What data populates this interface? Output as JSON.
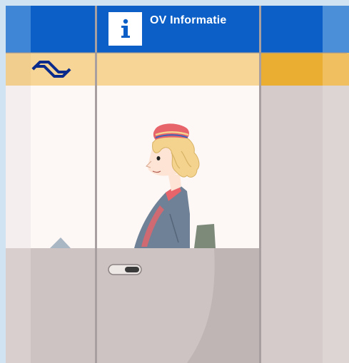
{
  "sign": {
    "title": "OV Informatie",
    "info_glyph": "i"
  },
  "logo": {
    "name": "ns-logo-icon"
  },
  "colors": {
    "sign_blue": "#0b5fc6",
    "sign_blue_light": "#4b8fd8",
    "band_yellow": "#f7d597",
    "band_yellow_dark": "#eaae33",
    "window_bg": "#fdf7f6",
    "panel_grey": "#cdc3c2",
    "frame_grey": "#a8a0a0",
    "wall_blue": "#cfe3f2"
  },
  "figure": {
    "name": "ticket-clerk"
  }
}
